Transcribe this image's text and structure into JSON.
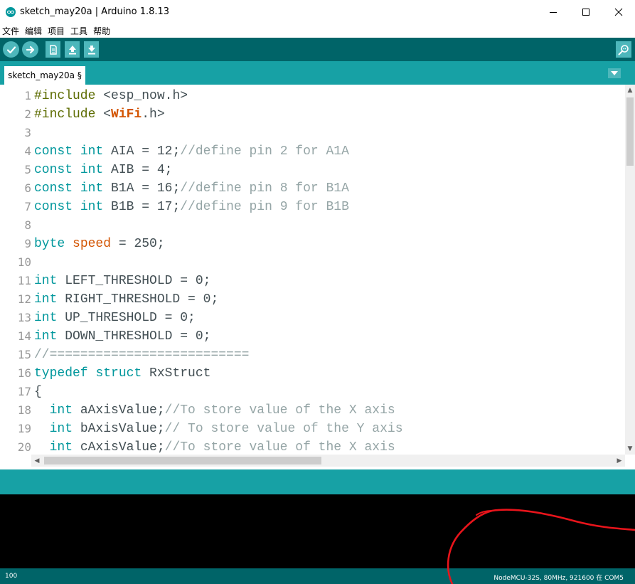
{
  "window": {
    "title": "sketch_may20a | Arduino 1.8.13"
  },
  "menu": [
    "文件",
    "编辑",
    "项目",
    "工具",
    "帮助"
  ],
  "toolbar": {
    "buttons": [
      "verify",
      "upload",
      "new",
      "open",
      "save"
    ],
    "serial_monitor": "serial-monitor"
  },
  "tabs": [
    {
      "label": "sketch_may20a §"
    }
  ],
  "editor": {
    "lines": [
      {
        "n": "1",
        "html": "<span class=\"pp\">#include</span> &lt;esp_now.h&gt;"
      },
      {
        "n": "2",
        "html": "<span class=\"pp\">#include</span> &lt;<span class=\"lib\">WiFi</span>.h&gt;"
      },
      {
        "n": "3",
        "html": ""
      },
      {
        "n": "4",
        "html": "<span class=\"kw\">const</span> <span class=\"kw\">int</span> AIA = 12;<span class=\"cm\">//define pin 2 for A1A</span>"
      },
      {
        "n": "5",
        "html": "<span class=\"kw\">const</span> <span class=\"kw\">int</span> AIB = 4;"
      },
      {
        "n": "6",
        "html": "<span class=\"kw\">const</span> <span class=\"kw\">int</span> B1A = 16;<span class=\"cm\">//define pin 8 for B1A</span>"
      },
      {
        "n": "7",
        "html": "<span class=\"kw\">const</span> <span class=\"kw\">int</span> B1B = 17;<span class=\"cm\">//define pin 9 for B1B</span>"
      },
      {
        "n": "8",
        "html": ""
      },
      {
        "n": "9",
        "html": "<span class=\"kw\">byte</span> <span class=\"fn\">speed</span> = 250;"
      },
      {
        "n": "10",
        "html": ""
      },
      {
        "n": "11",
        "html": "<span class=\"kw\">int</span> LEFT_THRESHOLD = 0;"
      },
      {
        "n": "12",
        "html": "<span class=\"kw\">int</span> RIGHT_THRESHOLD = 0;"
      },
      {
        "n": "13",
        "html": "<span class=\"kw\">int</span> UP_THRESHOLD = 0;"
      },
      {
        "n": "14",
        "html": "<span class=\"kw\">int</span> DOWN_THRESHOLD = 0;"
      },
      {
        "n": "15",
        "html": "<span class=\"cm\">//==========================</span>"
      },
      {
        "n": "16",
        "html": "<span class=\"kw\">typedef</span> <span class=\"kw\">struct</span> RxStruct"
      },
      {
        "n": "17",
        "html": "{"
      },
      {
        "n": "18",
        "html": "  <span class=\"kw\">int</span> aAxisValue;<span class=\"cm\">//To store value of the X axis</span>"
      },
      {
        "n": "19",
        "html": "  <span class=\"kw\">int</span> bAxisValue;<span class=\"cm\">// To store value of the Y axis</span>"
      },
      {
        "n": "20",
        "html": "  <span class=\"kw\">int</span> cAxisValue;<span class=\"cm\">//To store value of the X axis</span>"
      }
    ]
  },
  "status": {
    "line": "100",
    "board": "NodeMCU-32S, 80MHz, 921600 在 COM5"
  },
  "colors": {
    "toolbar": "#006468",
    "tabbar": "#17a1a5",
    "button": "#4db7bb",
    "console": "#000000",
    "annotation": "#e8141b"
  }
}
